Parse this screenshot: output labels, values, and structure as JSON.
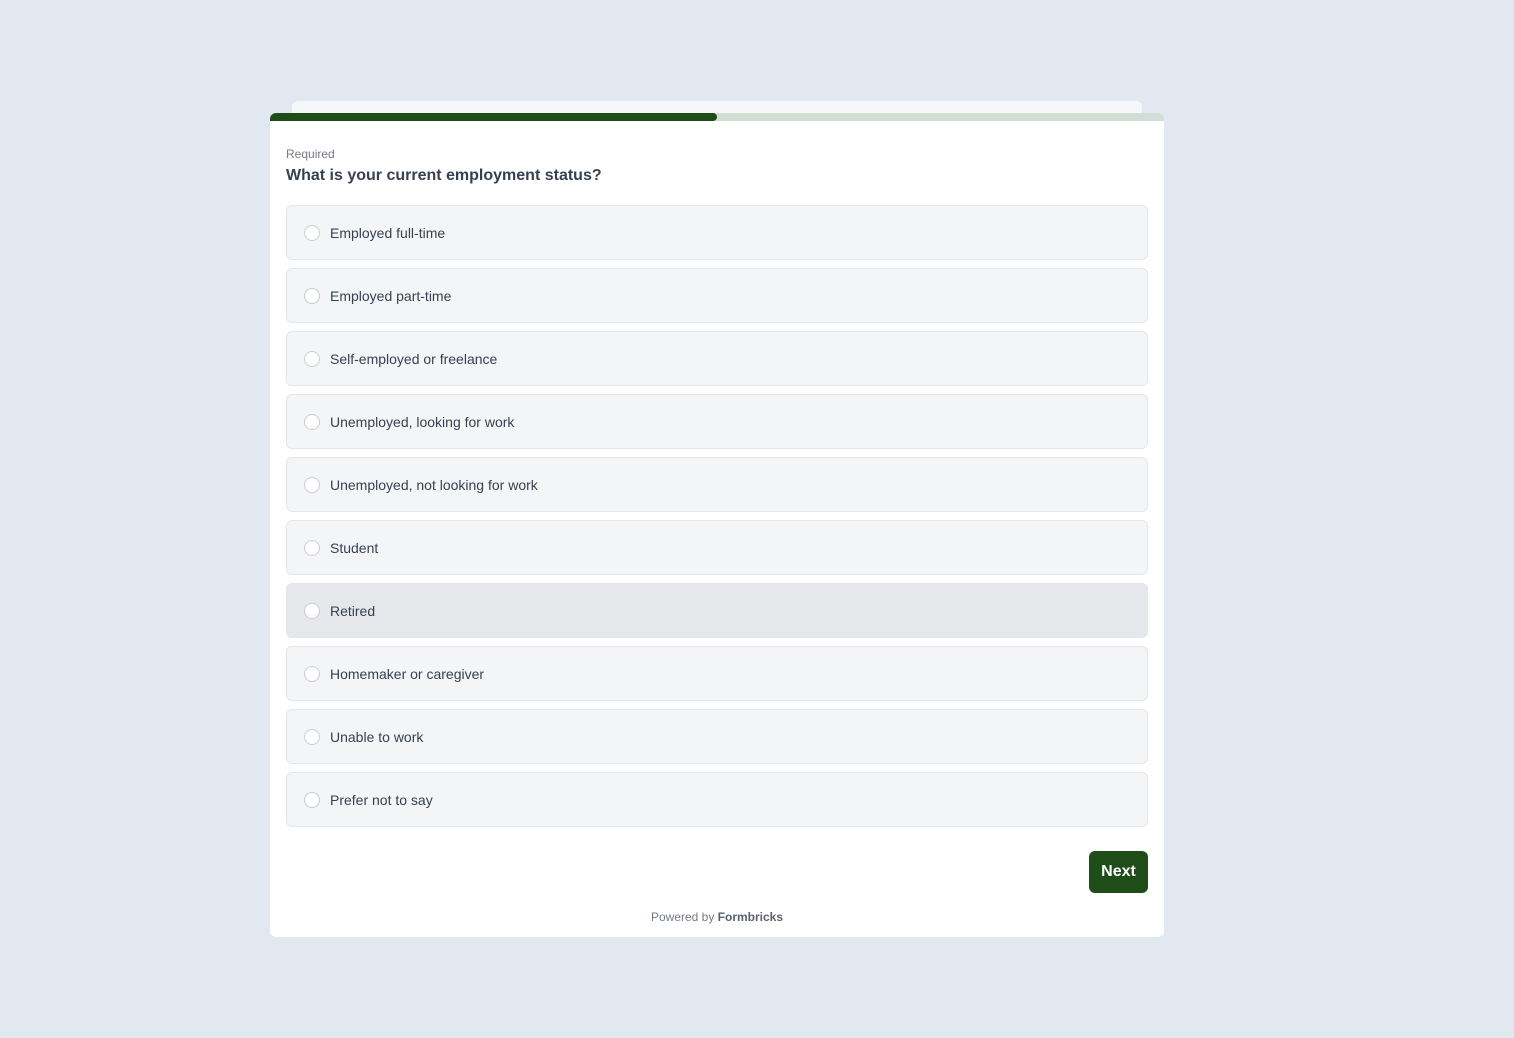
{
  "survey": {
    "progress_percent": 50,
    "required_label": "Required",
    "question": "What is your current employment status?",
    "options": [
      {
        "label": "Employed full-time",
        "selected": false
      },
      {
        "label": "Employed part-time",
        "selected": false
      },
      {
        "label": "Self-employed or freelance",
        "selected": false
      },
      {
        "label": "Unemployed, looking for work",
        "selected": false
      },
      {
        "label": "Unemployed, not looking for work",
        "selected": false
      },
      {
        "label": "Student",
        "selected": false
      },
      {
        "label": "Retired",
        "selected": false,
        "hovered": true
      },
      {
        "label": "Homemaker or caregiver",
        "selected": false
      },
      {
        "label": "Unable to work",
        "selected": false
      },
      {
        "label": "Prefer not to say",
        "selected": false
      }
    ],
    "next_label": "Next"
  },
  "footer": {
    "powered_by_prefix": "Powered by",
    "brand": "Formbricks"
  },
  "colors": {
    "background": "#e2e8f0",
    "brand": "#1e4d1a",
    "progress_track": "#d3ddd6",
    "option_background": "#f3f5f7",
    "option_hover": "#e5e7ea"
  }
}
